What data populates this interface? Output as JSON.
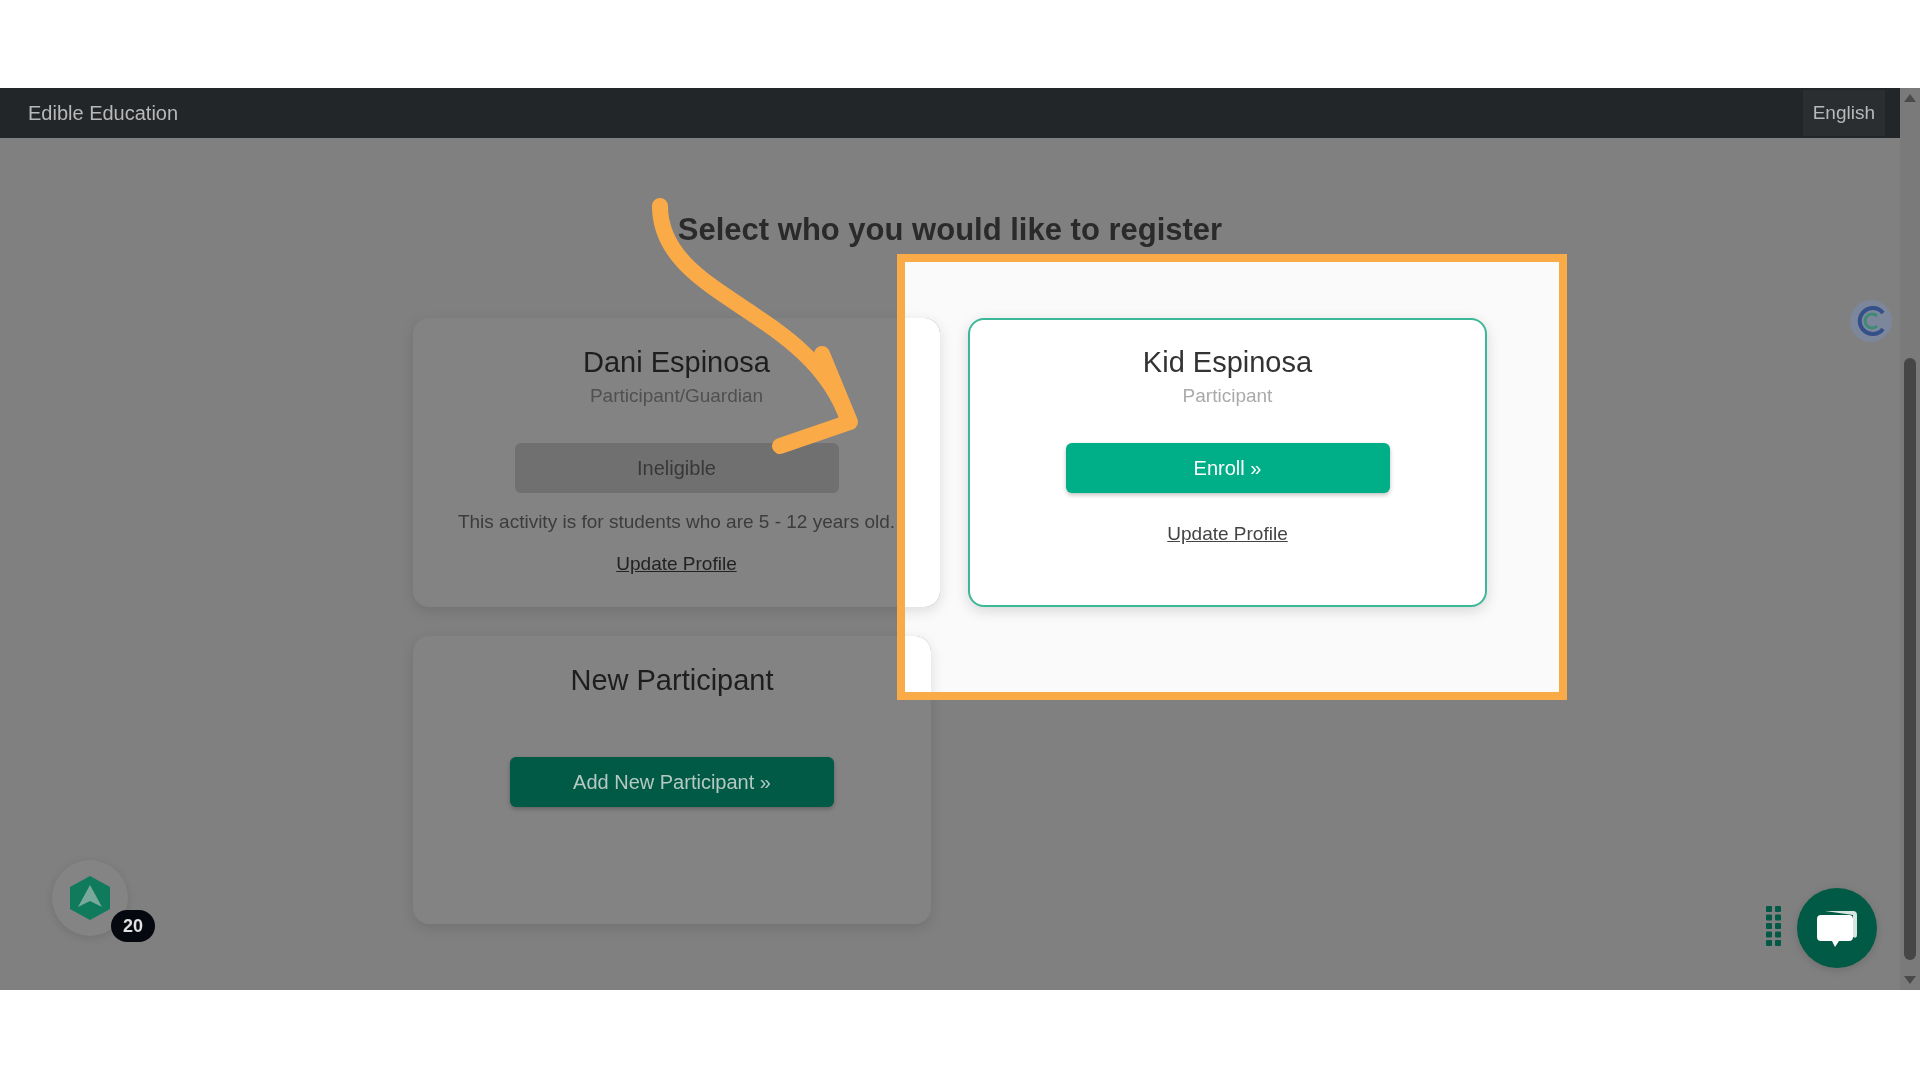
{
  "header": {
    "brand": "Edible Education",
    "language_button": "English"
  },
  "title": "Select who you would like to register",
  "participants": [
    {
      "name": "Dani Espinosa",
      "role": "Participant/Guardian",
      "eligible": false,
      "action": "Ineligible",
      "note": "This activity is for students who are 5 - 12 years old.",
      "link": "Update Profile",
      "highlighted": false
    },
    {
      "name": "Kid Espinosa",
      "role": "Participant",
      "eligible": true,
      "action": "Enroll »",
      "link": "Update Profile",
      "highlighted": true
    }
  ],
  "new_participant": {
    "title": "New Participant",
    "button": "Add New Participant »"
  },
  "widget_badge": "20"
}
